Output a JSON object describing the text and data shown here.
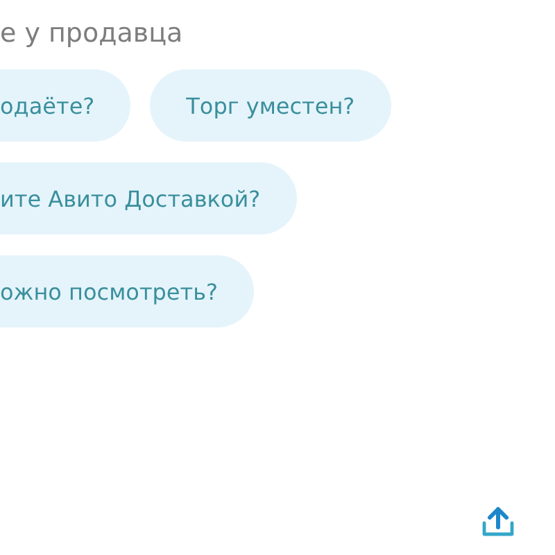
{
  "heading": "е у продавца",
  "questions": [
    [
      "одаёте?",
      "Торг уместен?"
    ],
    [
      "ите Авито Доставкой?"
    ],
    [
      "ожно посмотреть?"
    ]
  ]
}
